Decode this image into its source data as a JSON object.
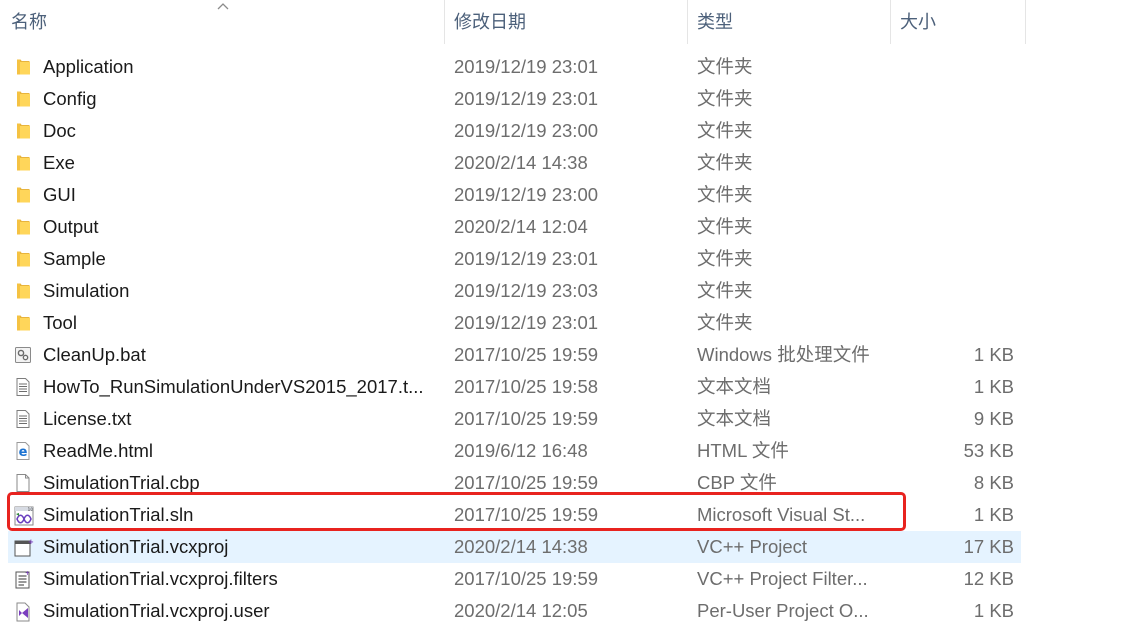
{
  "header": {
    "name": "名称",
    "date": "修改日期",
    "type": "类型",
    "size": "大小"
  },
  "files": [
    {
      "name": "Application",
      "date": "2019/12/19 23:01",
      "type": "文件夹",
      "size": "",
      "icon": "folder-icon"
    },
    {
      "name": "Config",
      "date": "2019/12/19 23:01",
      "type": "文件夹",
      "size": "",
      "icon": "folder-icon"
    },
    {
      "name": "Doc",
      "date": "2019/12/19 23:00",
      "type": "文件夹",
      "size": "",
      "icon": "folder-icon"
    },
    {
      "name": "Exe",
      "date": "2020/2/14 14:38",
      "type": "文件夹",
      "size": "",
      "icon": "folder-icon"
    },
    {
      "name": "GUI",
      "date": "2019/12/19 23:00",
      "type": "文件夹",
      "size": "",
      "icon": "folder-icon"
    },
    {
      "name": "Output",
      "date": "2020/2/14 12:04",
      "type": "文件夹",
      "size": "",
      "icon": "folder-icon"
    },
    {
      "name": "Sample",
      "date": "2019/12/19 23:01",
      "type": "文件夹",
      "size": "",
      "icon": "folder-icon"
    },
    {
      "name": "Simulation",
      "date": "2019/12/19 23:03",
      "type": "文件夹",
      "size": "",
      "icon": "folder-icon"
    },
    {
      "name": "Tool",
      "date": "2019/12/19 23:01",
      "type": "文件夹",
      "size": "",
      "icon": "folder-icon"
    },
    {
      "name": "CleanUp.bat",
      "date": "2017/10/25 19:59",
      "type": "Windows 批处理文件",
      "size": "1 KB",
      "icon": "batch-file-icon"
    },
    {
      "name": "HowTo_RunSimulationUnderVS2015_2017.t...",
      "date": "2017/10/25 19:58",
      "type": "文本文档",
      "size": "1 KB",
      "icon": "text-file-icon"
    },
    {
      "name": "License.txt",
      "date": "2017/10/25 19:59",
      "type": "文本文档",
      "size": "9 KB",
      "icon": "text-file-icon"
    },
    {
      "name": "ReadMe.html",
      "date": "2019/6/12 16:48",
      "type": "HTML 文件",
      "size": "53 KB",
      "icon": "edge-html-icon"
    },
    {
      "name": "SimulationTrial.cbp",
      "date": "2017/10/25 19:59",
      "type": "CBP 文件",
      "size": "8 KB",
      "icon": "blank-file-icon"
    },
    {
      "name": "SimulationTrial.sln",
      "date": "2017/10/25 19:59",
      "type": "Microsoft Visual St...",
      "size": "1 KB",
      "icon": "vs-solution-icon"
    },
    {
      "name": "SimulationTrial.vcxproj",
      "date": "2020/2/14 14:38",
      "type": "VC++ Project",
      "size": "17 KB",
      "icon": "vcxproj-icon"
    },
    {
      "name": "SimulationTrial.vcxproj.filters",
      "date": "2017/10/25 19:59",
      "type": "VC++ Project Filter...",
      "size": "12 KB",
      "icon": "filters-file-icon"
    },
    {
      "name": "SimulationTrial.vcxproj.user",
      "date": "2020/2/14 12:05",
      "type": "Per-User Project O...",
      "size": "1 KB",
      "icon": "vs-user-file-icon"
    }
  ],
  "hovered_row": "SimulationTrial.vcxproj",
  "annotation": {
    "color": "#e8231f",
    "target": "SimulationTrial.sln"
  }
}
